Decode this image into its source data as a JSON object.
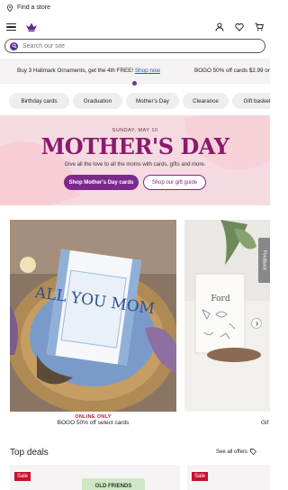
{
  "topbar": {
    "find_store": "Find a store"
  },
  "header": {
    "brand": "Hallmark"
  },
  "search": {
    "placeholder": "Search our site"
  },
  "promo": {
    "left_text": "Buy 3 Hallmark Ornaments, get the 4th FREE!",
    "left_link": "Shop now",
    "right_text": "BOGO 50% off cards $2.99 or"
  },
  "categories": [
    "Birthday cards",
    "Graduation",
    "Mother's Day",
    "Clearance",
    "Gift basket"
  ],
  "hero": {
    "date": "SUNDAY, MAY 10",
    "title": "MOTHER'S DAY",
    "subtitle": "Give all the love to all the moms with cards, gifts and more.",
    "primary_button": "Shop Mother's Day cards",
    "secondary_button": "Shop our gift guide"
  },
  "products": [
    {
      "badge": "ONLINE ONLY",
      "label": "BOGO 50% off select cards",
      "card_text": "ALL YOU MOM"
    },
    {
      "label": "Gif",
      "card_text": "Ford"
    }
  ],
  "feedback": "Feedback",
  "deals": {
    "title": "Top deals",
    "see_all": "See all offers",
    "items": [
      {
        "badge": "Sale",
        "product_text": "OLD FRIENDS"
      },
      {
        "badge": "Sale"
      }
    ]
  }
}
